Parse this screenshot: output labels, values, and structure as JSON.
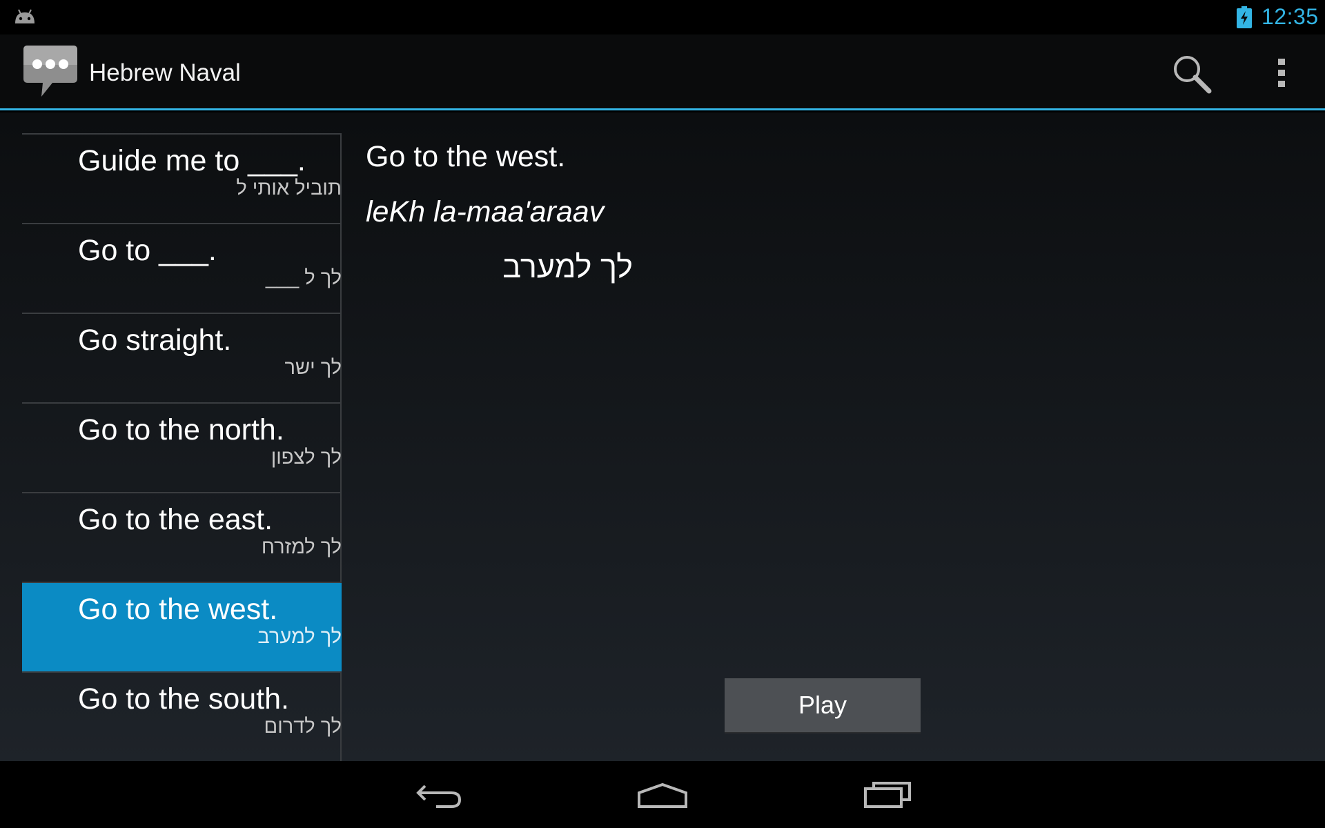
{
  "status_bar": {
    "time": "12:35",
    "left_icon": "android-icon",
    "battery_icon": "battery-charging-icon",
    "accent": "#33b5e5"
  },
  "action_bar": {
    "title": "Hebrew Naval",
    "app_icon": "speech-bubble-icon",
    "search_icon": "search-icon",
    "overflow_icon": "overflow-menu-icon"
  },
  "list": {
    "items": [
      {
        "english": "Guide me to ___.",
        "hebrew": "תוביל אותי ל"
      },
      {
        "english": "Go to ___.",
        "hebrew": "לך ל ___"
      },
      {
        "english": "Go straight.",
        "hebrew": "לך ישר"
      },
      {
        "english": "Go to the north.",
        "hebrew": "לך לצפון"
      },
      {
        "english": "Go to the east.",
        "hebrew": "לך למזרח"
      },
      {
        "english": "Go to the west.",
        "hebrew": "לך למערב"
      },
      {
        "english": "Go to the south.",
        "hebrew": "לך לדרום"
      }
    ],
    "selected_color": "#0b8bc4"
  },
  "detail": {
    "english": "Go to the west.",
    "transliteration": "leKh la-maa'araav",
    "hebrew": "לך למערב",
    "play_label": "Play"
  },
  "nav_bar": {
    "back_icon": "back-icon",
    "home_icon": "home-icon",
    "recents_icon": "recent-apps-icon"
  }
}
